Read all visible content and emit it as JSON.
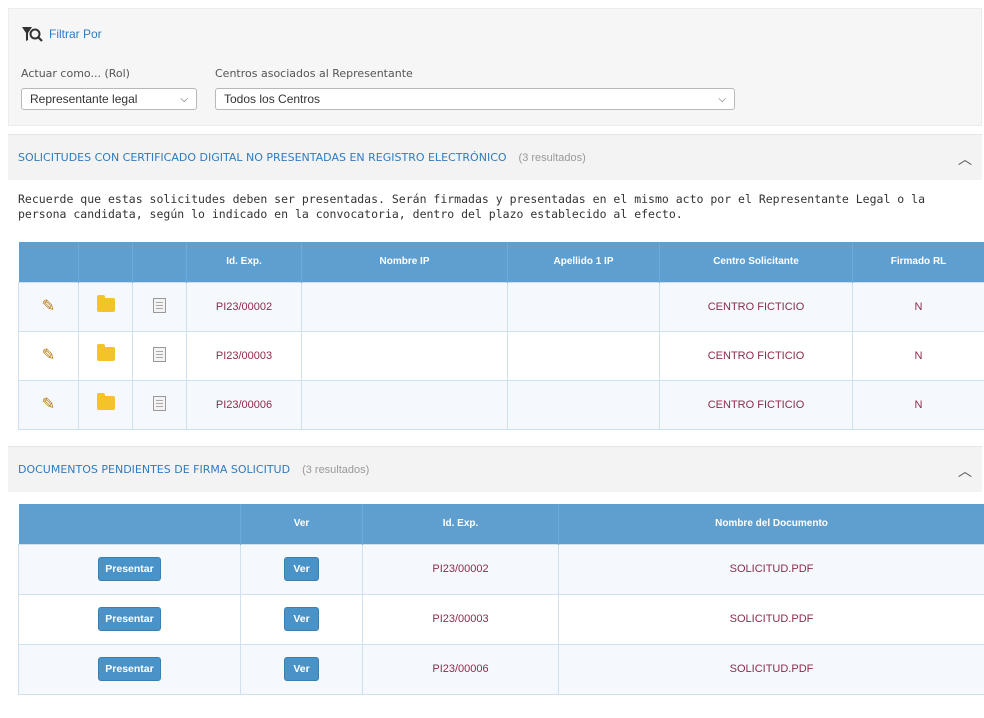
{
  "filter": {
    "title": "Filtrar Por",
    "role_label": "Actuar como... (Rol)",
    "role_value": "Representante legal",
    "centers_label": "Centros asociados al Representante",
    "centers_value": "Todos los Centros"
  },
  "section1": {
    "title": "SOLICITUDES CON CERTIFICADO DIGITAL NO PRESENTADAS EN REGISTRO ELECTRÓNICO",
    "count": "(3 resultados)",
    "notice": "Recuerde que estas solicitudes deben ser presentadas. Serán firmadas y presentadas en el mismo acto por el Representante Legal o la persona candidata, según lo indicado en la convocatoria, dentro del plazo establecido al efecto.",
    "headers": [
      "",
      "",
      "",
      "Id. Exp.",
      "Nombre IP",
      "Apellido 1 IP",
      "Centro Solicitante",
      "Firmado RL"
    ],
    "rows": [
      {
        "id": "PI23/00002",
        "nombre": "",
        "apellido": "",
        "centro": "CENTRO FICTICIO",
        "firmado": "N"
      },
      {
        "id": "PI23/00003",
        "nombre": "",
        "apellido": "",
        "centro": "CENTRO FICTICIO",
        "firmado": "N"
      },
      {
        "id": "PI23/00006",
        "nombre": "",
        "apellido": "",
        "centro": "CENTRO FICTICIO",
        "firmado": "N"
      }
    ]
  },
  "section2": {
    "title": "DOCUMENTOS PENDIENTES DE FIRMA SOLICITUD",
    "count": "(3 resultados)",
    "headers": [
      "",
      "Ver",
      "Id. Exp.",
      "Nombre del Documento"
    ],
    "present_label": "Presentar",
    "ver_label": "Ver",
    "rows": [
      {
        "id": "PI23/00002",
        "doc": "SOLICITUD.PDF"
      },
      {
        "id": "PI23/00003",
        "doc": "SOLICITUD.PDF"
      },
      {
        "id": "PI23/00006",
        "doc": "SOLICITUD.PDF"
      }
    ]
  },
  "icons": {
    "edit": "pencil-icon",
    "folder": "folder-icon",
    "document": "document-icon",
    "filter": "filter-search-icon",
    "collapse": "chevron-up-icon"
  },
  "colors": {
    "accent": "#2f7bbf",
    "header": "#5f9fd0",
    "button": "#4a93c9",
    "value_text": "#8a2c4a"
  }
}
